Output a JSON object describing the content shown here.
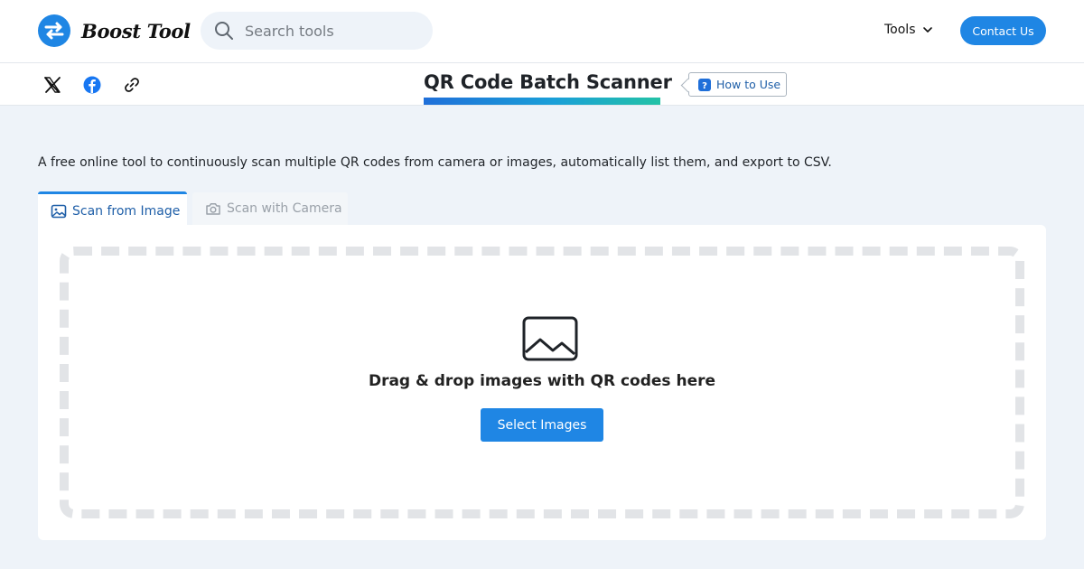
{
  "header": {
    "brand": "Boost Tool",
    "logo_icon": "boost-tool-logo-icon",
    "search": {
      "placeholder": "Search tools",
      "icon": "search-icon"
    },
    "tools_menu_label": "Tools",
    "contact_label": "Contact Us"
  },
  "share": {
    "items": [
      "x-icon",
      "facebook-icon",
      "link-icon"
    ]
  },
  "tool": {
    "title": "QR Code Batch Scanner",
    "how_to_label": "How to Use",
    "description": "A free online tool to continuously scan multiple QR codes from camera or images, automatically list them, and export to CSV."
  },
  "tabs": [
    {
      "label": "Scan from Image",
      "icon": "image-icon",
      "active": true
    },
    {
      "label": "Scan with Camera",
      "icon": "camera-icon",
      "active": false
    }
  ],
  "dropzone": {
    "text": "Drag & drop images with QR codes here",
    "button_label": "Select Images"
  },
  "colors": {
    "accent": "#1f86e4",
    "page_bg": "#eef3f9",
    "title_gradient": [
      "#1f6fd9",
      "#1a9fd8",
      "#23c2a6"
    ]
  }
}
